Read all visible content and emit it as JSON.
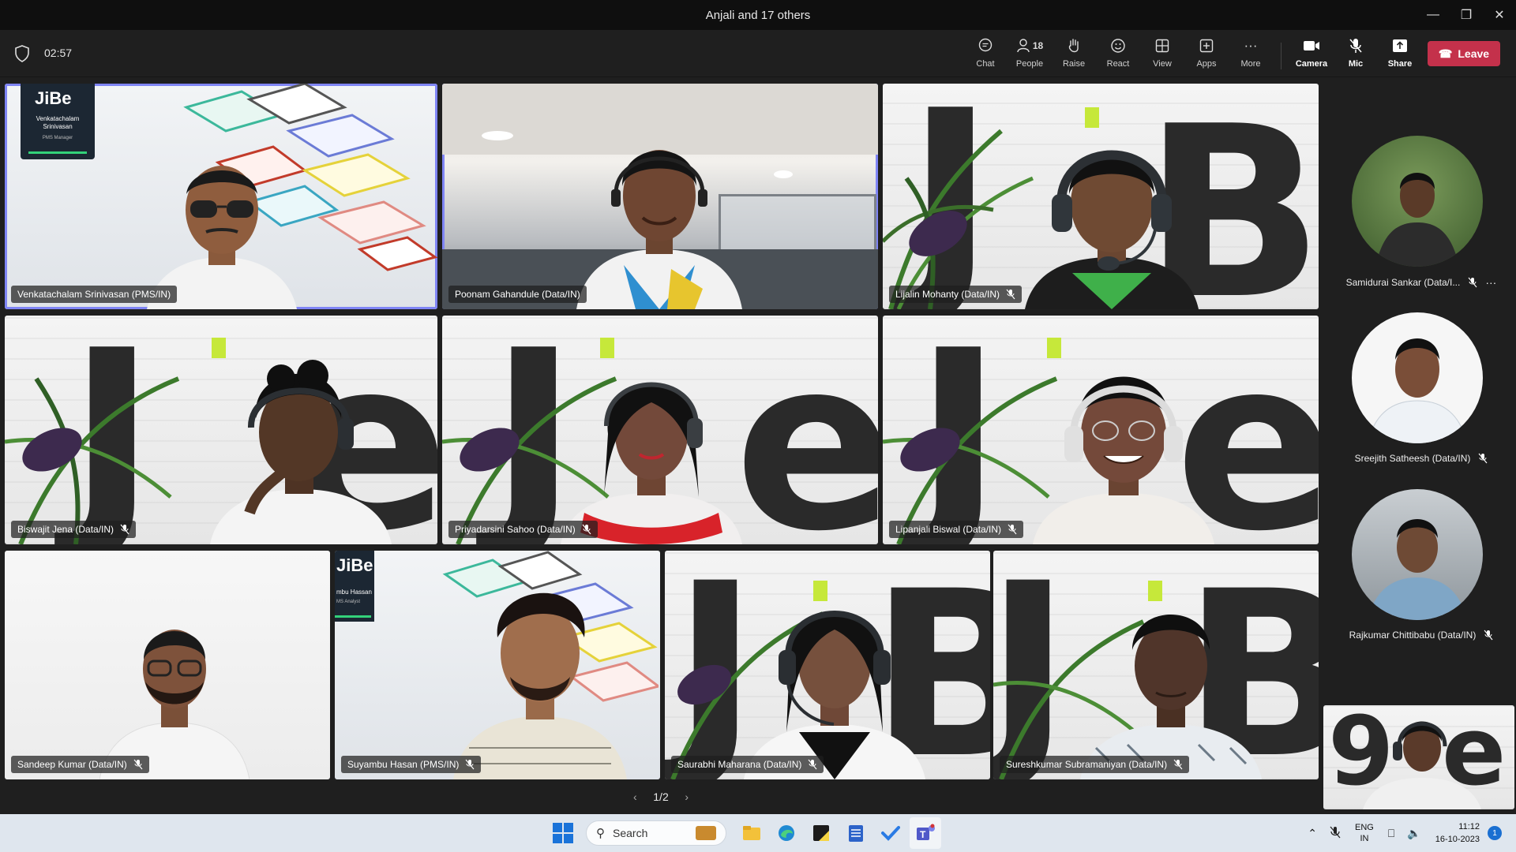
{
  "window": {
    "title": "Anjali and 17 others",
    "controls": [
      "minimize-icon",
      "restore-icon",
      "close-icon"
    ]
  },
  "toolbar": {
    "timer": "02:57",
    "buttons": {
      "chat": "Chat",
      "people": "People",
      "people_count": "18",
      "raise": "Raise",
      "react": "React",
      "view": "View",
      "apps": "Apps",
      "more": "More",
      "camera": "Camera",
      "mic": "Mic",
      "share": "Share"
    },
    "leave": "Leave",
    "leave_color": "#c4314b"
  },
  "tiles": [
    {
      "name": "Venkatachalam Srinivasan (PMS/IN)",
      "muted": false,
      "speaking": true
    },
    {
      "name": "Poonam Gahandule (Data/IN)",
      "muted": false,
      "speaking": true
    },
    {
      "name": "Lijalin Mohanty (Data/IN)",
      "muted": true
    },
    {
      "name": "Biswajit Jena (Data/IN)",
      "muted": true
    },
    {
      "name": "Priyadarsini Sahoo (Data/IN)",
      "muted": true
    },
    {
      "name": "Lipanjali Biswal (Data/IN)",
      "muted": true
    },
    {
      "name": "Sandeep Kumar (Data/IN)",
      "muted": true
    },
    {
      "name": "Suyambu Hasan (PMS/IN)",
      "muted": true
    },
    {
      "name": "Saurabhi Maharana (Data/IN)",
      "muted": true
    },
    {
      "name": "Sureshkumar Subramaniyan (Data/IN)",
      "muted": true
    }
  ],
  "background_text": {
    "logo": "JiBe",
    "card1_name": "Venkatachalam Srinivasan",
    "card1_role": "PMS Manager",
    "card2_name": "mbu Hassan",
    "card2_role": "MS Analyst"
  },
  "pager": {
    "label": "1/2"
  },
  "rail": [
    {
      "name": "Samidurai Sankar (Data/I...",
      "muted": true
    },
    {
      "name": "Sreejith Satheesh (Data/IN)",
      "muted": true
    },
    {
      "name": "Rajkumar Chittibabu (Data/IN)",
      "muted": true
    }
  ],
  "taskbar": {
    "search_placeholder": "Search",
    "lang_top": "ENG",
    "lang_bottom": "IN",
    "time": "11:12",
    "date": "16-10-2023",
    "notification_count": "1",
    "accent": "#1a6fd1"
  },
  "colors": {
    "speaking_border": "#7f85f5",
    "window_bg": "#1f1f1f"
  }
}
